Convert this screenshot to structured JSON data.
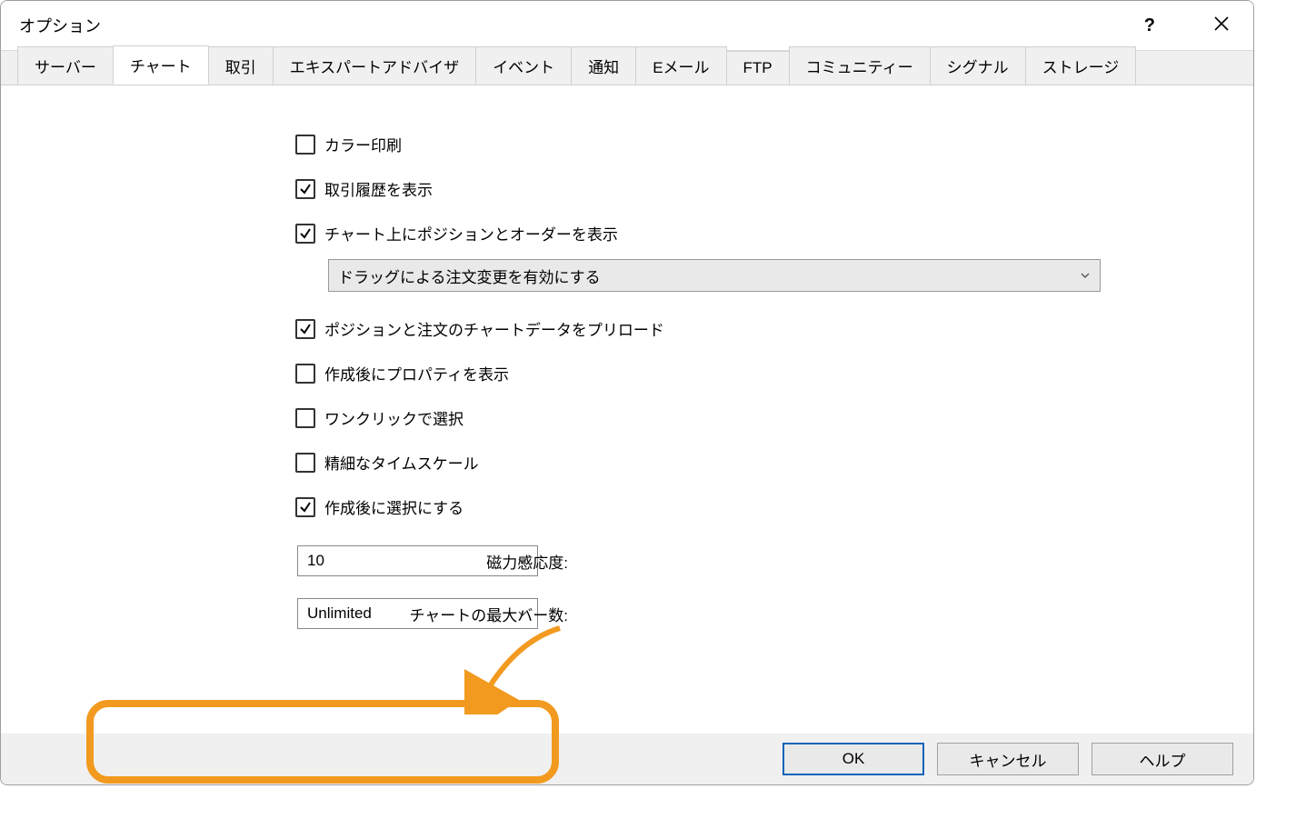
{
  "window": {
    "title": "オプション"
  },
  "tabs": [
    {
      "label": "サーバー"
    },
    {
      "label": "チャート"
    },
    {
      "label": "取引"
    },
    {
      "label": "エキスパートアドバイザ"
    },
    {
      "label": "イベント"
    },
    {
      "label": "通知"
    },
    {
      "label": "Eメール"
    },
    {
      "label": "FTP"
    },
    {
      "label": "コミュニティー"
    },
    {
      "label": "シグナル"
    },
    {
      "label": "ストレージ"
    }
  ],
  "options": {
    "color_print": "カラー印刷",
    "show_history": "取引履歴を表示",
    "show_positions": "チャート上にポジションとオーダーを表示",
    "drag_order_combo": "ドラッグによる注文変更を有効にする",
    "preload_chart": "ポジションと注文のチャートデータをプリロード",
    "show_props": "作成後にプロパティを表示",
    "oneclick_select": "ワンクリックで選択",
    "precise_timescale": "精細なタイムスケール",
    "select_after_create": "作成後に選択にする"
  },
  "fields": {
    "magnet_label": "磁力感応度:",
    "magnet_value": "10",
    "maxbars_label": "チャートの最大バー数:",
    "maxbars_value": "Unlimited"
  },
  "buttons": {
    "ok": "OK",
    "cancel": "キャンセル",
    "help": "ヘルプ"
  }
}
